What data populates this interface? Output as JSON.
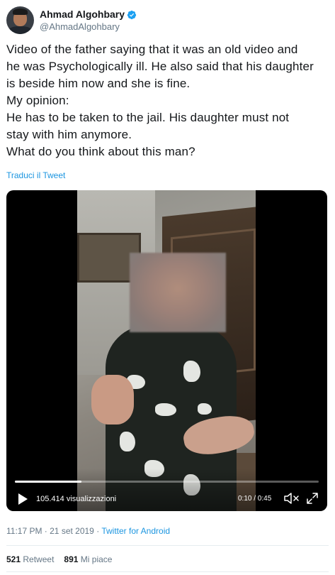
{
  "author": {
    "display_name": "Ahmad Algohbary",
    "handle": "@AhmadAlgohbary",
    "verified": true,
    "avatar_icon": "profile-photo"
  },
  "tweet": {
    "lines": [
      "Video of the father saying that it was an old video and",
      "he was Psychologically ill. He also said that his daughter",
      "is beside him now and she is fine.",
      "My opinion:",
      "He has to be taken to the jail. His daughter must not",
      "stay with him anymore.",
      "What do you think about this man?"
    ],
    "translate_label": "Traduci il Tweet"
  },
  "video": {
    "views": "105.414 visualizzazioni",
    "time": "0:10 / 0:45",
    "progress_fraction": 0.22,
    "play_icon": "play-icon",
    "mute_icon": "volume-muted-icon",
    "expand_icon": "fullscreen-icon"
  },
  "meta": {
    "timestamp": "11:17 PM · 21 set 2019",
    "separator": "·",
    "source": "Twitter for Android"
  },
  "stats": {
    "retweets_count": "521",
    "retweets_label": "Retweet",
    "likes_count": "891",
    "likes_label": "Mi piace"
  },
  "colors": {
    "link": "#1b95e0",
    "secondary_text": "#657786",
    "primary_text": "#14171a",
    "verified": "#1da1f2"
  }
}
